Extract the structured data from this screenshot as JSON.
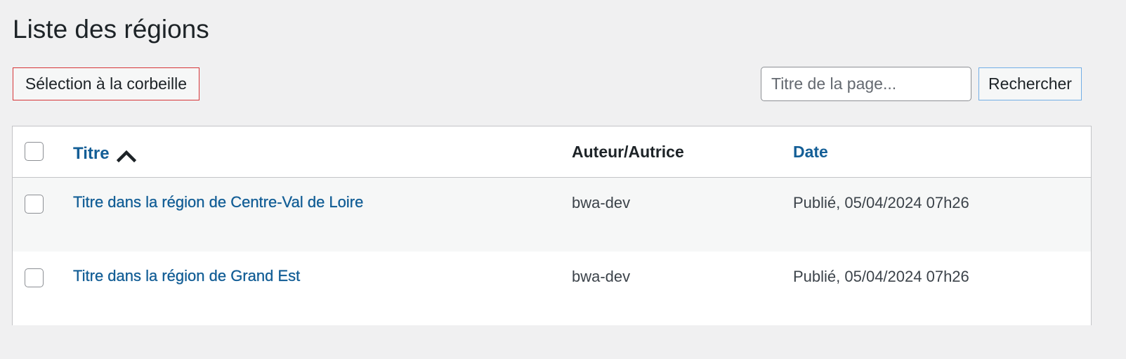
{
  "page": {
    "title": "Liste des régions"
  },
  "bulk_action": {
    "label": "Sélection à la corbeille"
  },
  "search": {
    "value": "",
    "placeholder": "Titre de la page...",
    "button_label": "Rechercher"
  },
  "table": {
    "columns": {
      "title": "Titre",
      "author": "Auteur/Autrice",
      "date": "Date"
    },
    "sort": {
      "column": "title",
      "direction": "ascending",
      "icon": "chevron-up-icon"
    },
    "rows": [
      {
        "title": "Titre dans la région de Centre-Val de Loire",
        "author": "bwa-dev",
        "date": "Publié, 05/04/2024 07h26",
        "selected": false
      },
      {
        "title": "Titre dans la région de Grand Est",
        "author": "bwa-dev",
        "date": "Publié, 05/04/2024 07h26",
        "selected": false
      }
    ]
  },
  "colors": {
    "background": "#f0f0f1",
    "link": "#135e96",
    "danger_border": "#d63638",
    "focus_border": "#72aee6",
    "row_alt": "#f6f7f7"
  }
}
